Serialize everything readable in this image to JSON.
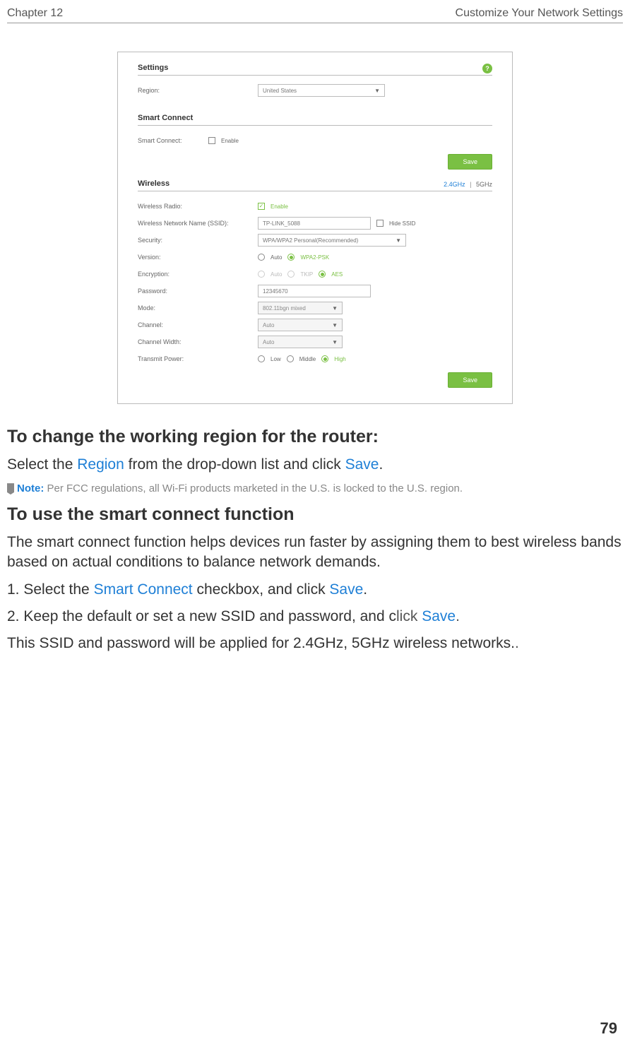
{
  "header": {
    "chapter": "Chapter 12",
    "section": "Customize Your Network Settings"
  },
  "panel": {
    "help_icon": "?",
    "settings": {
      "title": "Settings",
      "region_label": "Region:",
      "region_value": "United States"
    },
    "smart_connect": {
      "title": "Smart Connect",
      "label": "Smart Connect:",
      "enable_label": "Enable",
      "enable_checked": false,
      "save": "Save"
    },
    "wireless": {
      "title": "Wireless",
      "band_active": "2.4GHz",
      "band_sep": "|",
      "band_inactive": "5GHz",
      "rows": {
        "radio_label": "Wireless Radio:",
        "radio_enable": "Enable",
        "ssid_label": "Wireless Network Name (SSID):",
        "ssid_value": "TP-LINK_5088",
        "hide_ssid": "Hide SSID",
        "security_label": "Security:",
        "security_value": "WPA/WPA2 Personal(Recommended)",
        "version_label": "Version:",
        "version_auto": "Auto",
        "version_wpa2": "WPA2-PSK",
        "encryption_label": "Encryption:",
        "encryption_auto": "Auto",
        "encryption_tkip": "TKIP",
        "encryption_aes": "AES",
        "password_label": "Password:",
        "password_value": "12345670",
        "mode_label": "Mode:",
        "mode_value": "802.11bgn mixed",
        "channel_label": "Channel:",
        "channel_value": "Auto",
        "width_label": "Channel Width:",
        "width_value": "Auto",
        "power_label": "Transmit Power:",
        "power_low": "Low",
        "power_middle": "Middle",
        "power_high": "High"
      },
      "save": "Save"
    }
  },
  "body": {
    "h_region": "To change the working region for the router:",
    "p_region_1": "Select the ",
    "p_region_link": "Region",
    "p_region_2": " from the drop-down list and click ",
    "p_region_save": "Save",
    "p_region_3": ".",
    "note_label": "Note:",
    "note_text": " Per FCC regulations, all Wi-Fi products marketed in the U.S. is locked to the U.S. region.",
    "h_smart": "To use the smart connect function",
    "p_smart_desc": "The smart connect function helps devices run faster by assigning them to best wireless bands based on actual conditions to balance network demands.",
    "li1_a": "1. Select the ",
    "li1_link": "Smart Connect",
    "li1_b": " checkbox, and click ",
    "li1_save": "Save",
    "li1_c": ".",
    "li2_a": "2. Keep the default or set a new SSID and password, and c",
    "li2_lick": "lick ",
    "li2_save": "Save",
    "li2_b": ".",
    "p_final": "This SSID and password will be applied for 2.4GHz, 5GHz wireless networks."
  },
  "page_number": "79"
}
